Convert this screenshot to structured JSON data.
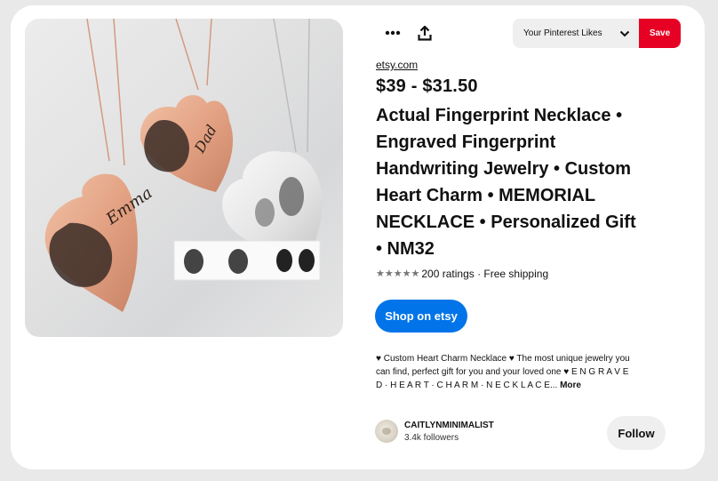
{
  "header": {
    "more_icon": "more-dots-icon",
    "share_icon": "share-upload-icon",
    "board_select": "Your Pinterest Likes",
    "save_label": "Save"
  },
  "image": {
    "engraving_1": "Emma",
    "engraving_2": "Dad"
  },
  "pin": {
    "source": "etsy.com",
    "price": "$39 - $31.50",
    "title_lines": [
      "Actual Fingerprint Necklace •",
      "Engraved Fingerprint",
      "Handwriting Jewelry • Custom",
      "Heart Charm • MEMORIAL",
      "NECKLACE • Personalized Gift",
      "• NM32"
    ],
    "rating_count": "200 ratings",
    "rating_extra": " · Free shipping",
    "stars": 5,
    "shop_label": "Shop on etsy",
    "description_lines": [
      "♥ Custom Heart Charm Necklace ♥ The most unique jewelry you",
      "can find, perfect gift for you and your loved one ♥ E N G R A V E",
      "D · H E A R T · C H A R M · N E C K L A C E..."
    ],
    "more_label": "More"
  },
  "creator": {
    "name": "CAITLYNMINIMALIST",
    "followers": "3.4k followers",
    "follow_label": "Follow"
  },
  "colors": {
    "save": "#e60023",
    "shop": "#0074e8",
    "rose_gold": "#e6a98c",
    "silver": "#dcdcdc"
  }
}
